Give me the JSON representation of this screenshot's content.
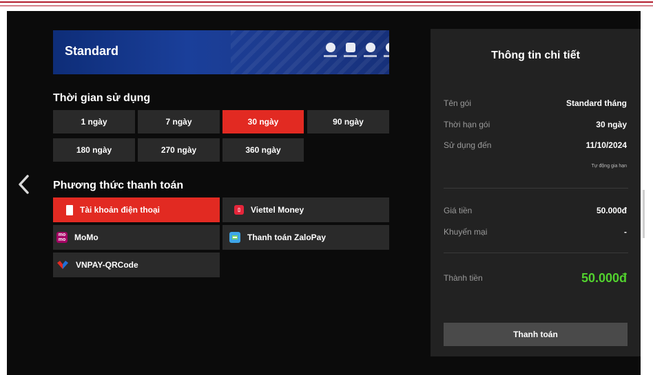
{
  "banner": {
    "title": "Standard",
    "logos": [
      "champions-league-logo",
      "europa-league-logo",
      "premier-league-logo",
      "european-qualifiers-logo",
      "vleague-logo"
    ]
  },
  "duration": {
    "title": "Thời gian sử dụng",
    "options": [
      "1 ngày",
      "7 ngày",
      "30 ngày",
      "90 ngày",
      "180 ngày",
      "270 ngày",
      "360 ngày"
    ],
    "selected": "30 ngày"
  },
  "payment": {
    "title": "Phương thức thanh toán",
    "methods": [
      {
        "label": "Tài khoản điện thoại",
        "icon": "phone-icon"
      },
      {
        "label": "Viettel Money",
        "icon": "viettel-money-icon"
      },
      {
        "label": "MoMo",
        "icon": "momo-icon"
      },
      {
        "label": "Thanh toán ZaloPay",
        "icon": "zalopay-icon"
      },
      {
        "label": "VNPAY-QRCode",
        "icon": "vnpay-icon"
      }
    ],
    "selected": "Tài khoản điện thoại"
  },
  "details": {
    "title": "Thông tin chi tiết",
    "package_label": "Tên gói",
    "package_value": "Standard tháng",
    "term_label": "Thời hạn gói",
    "term_value": "30 ngày",
    "until_label": "Sử dụng đến",
    "until_value": "11/10/2024",
    "auto_renew": "Tự động gia hạn",
    "price_label": "Giá tiền",
    "price_value": "50.000đ",
    "discount_label": "Khuyến mại",
    "discount_value": "-",
    "total_label": "Thành tiền",
    "total_value": "50.000đ",
    "pay_button": "Thanh toán"
  },
  "colors": {
    "accent": "#e22a22",
    "total_green": "#52d22e",
    "panel": "#222222",
    "background": "#0b0b0b"
  }
}
